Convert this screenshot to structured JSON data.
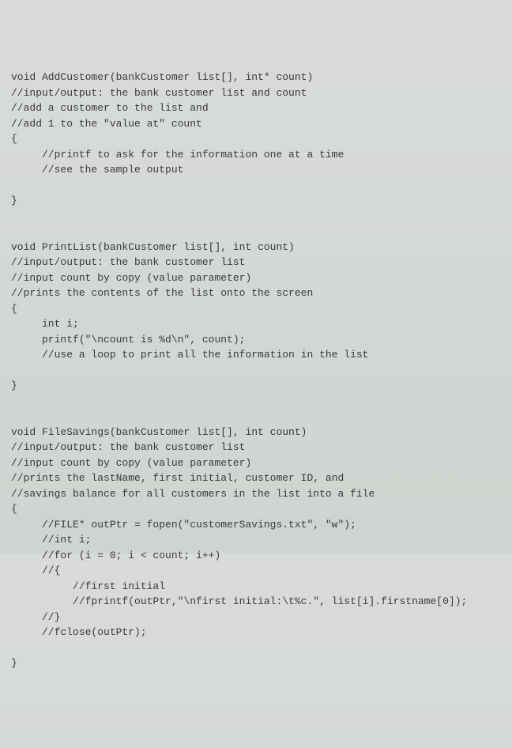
{
  "code": {
    "lines": [
      "void AddCustomer(bankCustomer list[], int* count)",
      "//input/output: the bank customer list and count",
      "//add a customer to the list and",
      "//add 1 to the \"value at\" count",
      "{",
      "     //printf to ask for the information one at a time",
      "     //see the sample output",
      "",
      "}",
      "",
      "",
      "void PrintList(bankCustomer list[], int count)",
      "//input/output: the bank customer list",
      "//input count by copy (value parameter)",
      "//prints the contents of the list onto the screen",
      "{",
      "     int i;",
      "     printf(\"\\ncount is %d\\n\", count);",
      "     //use a loop to print all the information in the list",
      "",
      "}",
      "",
      "",
      "void FileSavings(bankCustomer list[], int count)",
      "//input/output: the bank customer list",
      "//input count by copy (value parameter)",
      "//prints the lastName, first initial, customer ID, and",
      "//savings balance for all customers in the list into a file",
      "{",
      "     //FILE* outPtr = fopen(\"customerSavings.txt\", \"w\");",
      "     //int i;",
      "     //for (i = 0; i < count; i++)",
      "     //{",
      "          //first initial",
      "          //fprintf(outPtr,\"\\nfirst initial:\\t%c.\", list[i].firstname[0]);",
      "     //}",
      "     //fclose(outPtr);",
      "",
      "}"
    ]
  }
}
